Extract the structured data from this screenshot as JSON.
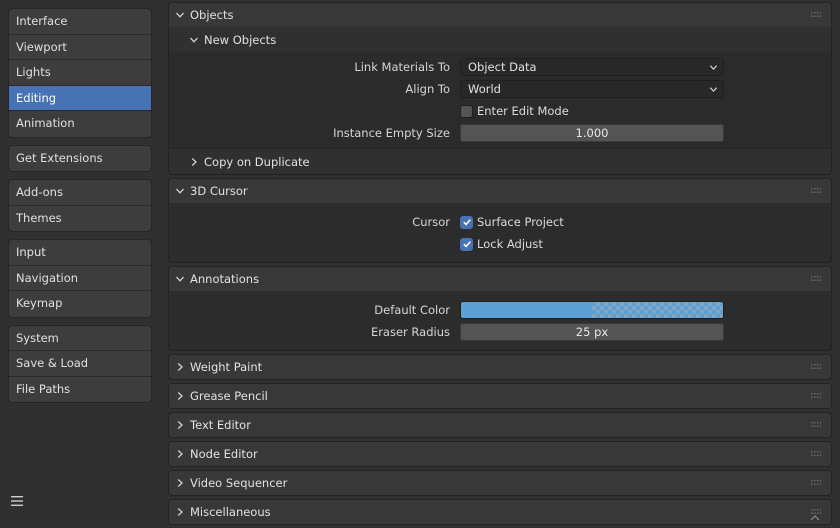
{
  "sidebar": {
    "groups": [
      [
        "Interface",
        "Viewport",
        "Lights",
        "Editing",
        "Animation"
      ],
      [
        "Get Extensions"
      ],
      [
        "Add-ons",
        "Themes"
      ],
      [
        "Input",
        "Navigation",
        "Keymap"
      ],
      [
        "System",
        "Save & Load",
        "File Paths"
      ]
    ],
    "active": "Editing"
  },
  "objects": {
    "title": "Objects",
    "new_objects": {
      "title": "New Objects",
      "link_materials_label": "Link Materials To",
      "link_materials_value": "Object Data",
      "align_to_label": "Align To",
      "align_to_value": "World",
      "enter_edit_mode_label": "Enter Edit Mode",
      "enter_edit_mode_checked": false,
      "instance_empty_size_label": "Instance Empty Size",
      "instance_empty_size_value": "1.000"
    },
    "copy_on_duplicate": "Copy on Duplicate"
  },
  "cursor": {
    "title": "3D Cursor",
    "cursor_label": "Cursor",
    "surface_project_label": "Surface Project",
    "surface_project_checked": true,
    "lock_adjust_label": "Lock Adjust",
    "lock_adjust_checked": true
  },
  "annotations": {
    "title": "Annotations",
    "default_color_label": "Default Color",
    "default_color_value": "#5c9fd3",
    "eraser_radius_label": "Eraser Radius",
    "eraser_radius_value": "25 px"
  },
  "collapsed_panels": [
    "Weight Paint",
    "Grease Pencil",
    "Text Editor",
    "Node Editor",
    "Video Sequencer",
    "Miscellaneous"
  ],
  "colors": {
    "accent": "#4772b3",
    "background": "#303030"
  }
}
